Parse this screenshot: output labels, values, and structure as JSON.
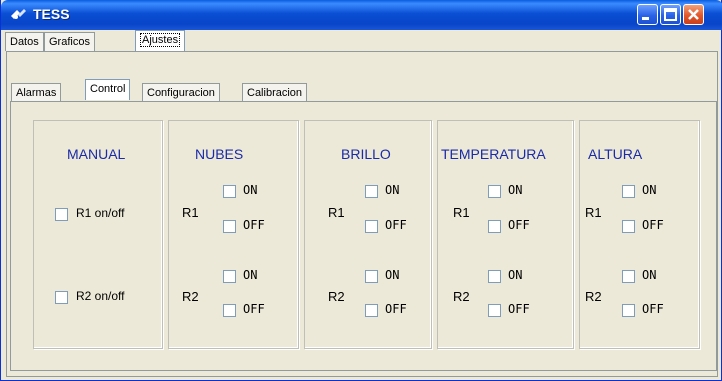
{
  "window": {
    "title": "TESS",
    "icon": "satellite-icon"
  },
  "outer_tabs": [
    {
      "label": "Datos"
    },
    {
      "label": "Graficos"
    },
    {
      "label": "Ajustes",
      "active": true
    }
  ],
  "inner_tabs": [
    {
      "label": "Alarmas"
    },
    {
      "label": "Control",
      "active": true
    },
    {
      "label": "Configuracion"
    },
    {
      "label": "Calibracion"
    }
  ],
  "control": {
    "manual": {
      "title": "MANUAL",
      "r1_label": "R1 on/off",
      "r2_label": "R2 on/off"
    },
    "groups": [
      {
        "title": "NUBES",
        "r1": "R1",
        "r2": "R2",
        "on": "ON",
        "off": "OFF"
      },
      {
        "title": "BRILLO",
        "r1": "R1",
        "r2": "R2",
        "on": "ON",
        "off": "OFF"
      },
      {
        "title": "TEMPERATURA",
        "r1": "R1",
        "r2": "R2",
        "on": "ON",
        "off": "OFF"
      },
      {
        "title": "ALTURA",
        "r1": "R1",
        "r2": "R2",
        "on": "ON",
        "off": "OFF"
      }
    ]
  },
  "colors": {
    "titlebar": "#0a4fd4",
    "group_title": "#1a2aa8",
    "face": "#ece9d8"
  }
}
